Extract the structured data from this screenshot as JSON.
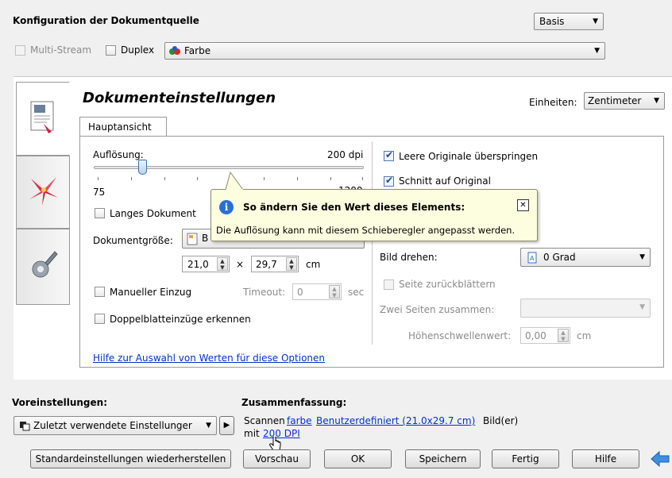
{
  "source_config": {
    "title": "Konfiguration der Dokumentquelle",
    "mode_combo": "Basis",
    "multistream_label": "Multi-Stream",
    "duplex_label": "Duplex",
    "color_combo": "Farbe"
  },
  "panel": {
    "heading": "Dokumenteinstellungen",
    "units_label": "Einheiten:",
    "units_value": "Zentimeter",
    "tab_main": "Hauptansicht"
  },
  "left_col": {
    "resolution_label": "Auflösung:",
    "resolution_value": "200 dpi",
    "slider_min": "75",
    "slider_max": "1200",
    "slider_level_pct": 18,
    "long_doc_label": "Langes Dokument",
    "doc_size_label": "Dokumentgröße:",
    "doc_size_value": "B",
    "width_value": "21,0",
    "times": "×",
    "height_value": "29,7",
    "size_unit": "cm",
    "manual_feed_label": "Manueller Einzug",
    "timeout_label": "Timeout:",
    "timeout_value": "0",
    "timeout_unit": "sec",
    "double_feed_label": "Doppelblatteinzüge erkennen",
    "help_link": "Hilfe zur Auswahl von Werten für diese Optionen"
  },
  "right_col": {
    "skip_blank_label": "Leere Originale überspringen",
    "crop_label": "Schnitt auf Original",
    "rotate_label": "Bild drehen:",
    "rotate_value": "0 Grad",
    "page_back_label": "Seite zurückblättern",
    "merge_label": "Zwei Seiten zusammen:",
    "merge_value": "",
    "threshold_label": "Höhenschwellenwert:",
    "threshold_value": "0,00",
    "threshold_unit": "cm"
  },
  "tooltip": {
    "title": "So ändern Sie den Wert dieses Elements:",
    "body": "Die Auflösung kann mit diesem Schieberegler angepasst werden.",
    "close": "✕"
  },
  "presets": {
    "label": "Voreinstellungen:",
    "value": "Zuletzt verwendete Einstellunger"
  },
  "summary": {
    "label": "Zusammenfassung:",
    "line1_prefix": "Scannen",
    "color_link": "farbe",
    "size_link": "Benutzerdefiniert (21.0x29.7 cm)",
    "line1_suffix": "Bild(er)",
    "line2_prefix": "mit",
    "dpi_link": "200 DPI"
  },
  "buttons": {
    "restore": "Standardeinstellungen wiederherstellen",
    "preview": "Vorschau",
    "ok": "OK",
    "save": "Speichern",
    "done": "Fertig",
    "help": "Hilfe"
  },
  "colors": {
    "link": "#0033cc",
    "tooltip_bg": "#fdfde0",
    "info_blue": "#2a6fd6"
  }
}
